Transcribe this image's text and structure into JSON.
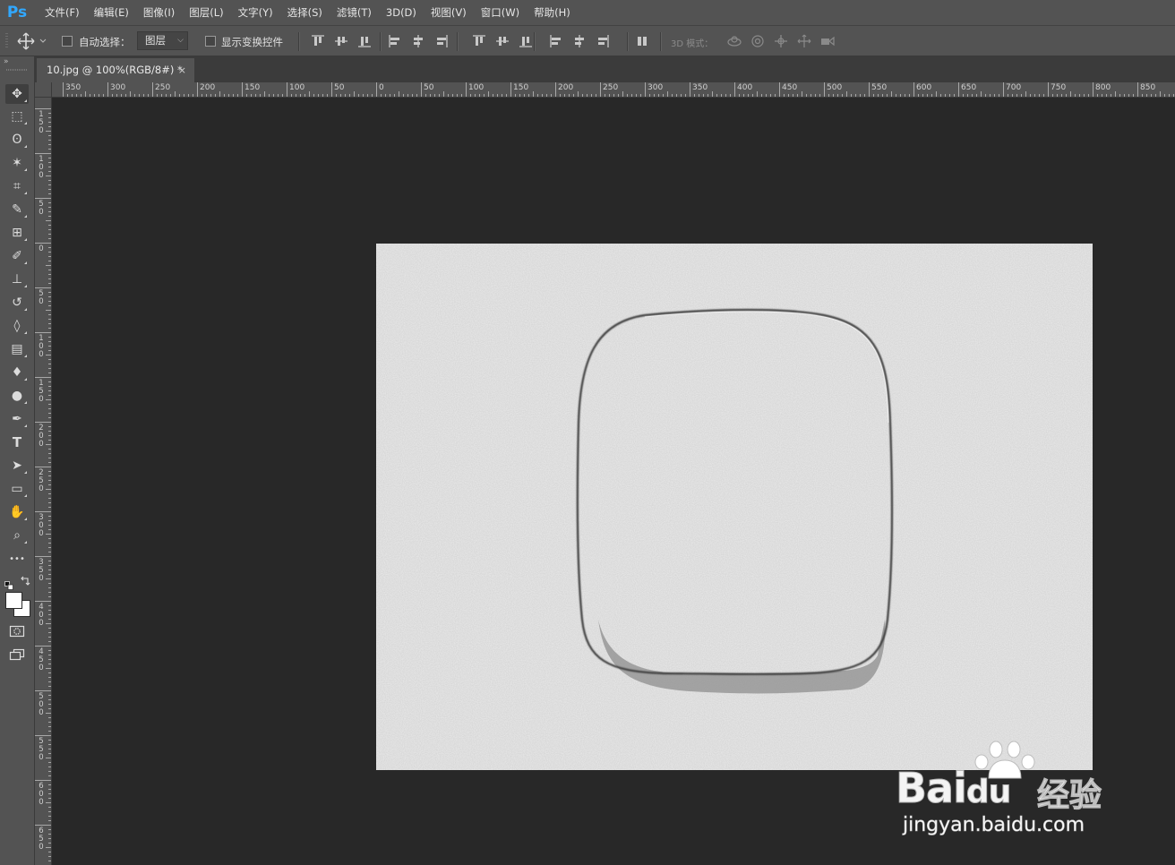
{
  "app": {
    "logo": "Ps"
  },
  "menu": [
    "文件(F)",
    "编辑(E)",
    "图像(I)",
    "图层(L)",
    "文字(Y)",
    "选择(S)",
    "滤镜(T)",
    "3D(D)",
    "视图(V)",
    "窗口(W)",
    "帮助(H)"
  ],
  "options": {
    "auto_select_label": "自动选择：",
    "auto_select_checked": false,
    "layer_select_value": "图层",
    "show_transform_label": "显示变换控件",
    "show_transform_checked": false,
    "mode_3d_label": "3D 模式："
  },
  "document": {
    "tab_title": "10.jpg @ 100%(RGB/8#) *",
    "close_glyph": "×"
  },
  "rulers": {
    "h_labels": [
      "350",
      "300",
      "250",
      "200",
      "150",
      "100",
      "50",
      "0",
      "50",
      "100",
      "150",
      "200",
      "250",
      "300",
      "350",
      "400",
      "450",
      "500",
      "550",
      "600",
      "650",
      "700",
      "750",
      "800",
      "850"
    ],
    "v_labels": [
      "1 5 0",
      "1 0 0",
      "5 0",
      "0",
      "5 0",
      "1 0 0",
      "1 5 0",
      "2 0 0",
      "2 5 0",
      "3 0 0",
      "3 5 0",
      "4 0 0",
      "4 5 0",
      "5 0 0",
      "5 5 0",
      "6 0 0",
      "6 5 0"
    ]
  },
  "tools": [
    {
      "name": "move-tool-icon",
      "glyph": "✥",
      "active": true
    },
    {
      "name": "marquee-tool-icon",
      "glyph": "⬚"
    },
    {
      "name": "lasso-tool-icon",
      "glyph": "ʘ"
    },
    {
      "name": "magic-wand-tool-icon",
      "glyph": "✶"
    },
    {
      "name": "crop-tool-icon",
      "glyph": "⌗"
    },
    {
      "name": "eyedropper-tool-icon",
      "glyph": "✎"
    },
    {
      "name": "frame-tool-icon",
      "glyph": "⊞"
    },
    {
      "name": "brush-tool-icon",
      "glyph": "✐"
    },
    {
      "name": "stamp-tool-icon",
      "glyph": "⊥"
    },
    {
      "name": "history-brush-tool-icon",
      "glyph": "↺"
    },
    {
      "name": "eraser-tool-icon",
      "glyph": "◊"
    },
    {
      "name": "gradient-tool-icon",
      "glyph": "▤"
    },
    {
      "name": "blur-tool-icon",
      "glyph": "♦"
    },
    {
      "name": "dodge-tool-icon",
      "glyph": "●"
    },
    {
      "name": "pen-tool-icon",
      "glyph": "✒"
    },
    {
      "name": "type-tool-icon",
      "glyph": "T"
    },
    {
      "name": "path-select-tool-icon",
      "glyph": "➤"
    },
    {
      "name": "rectangle-tool-icon",
      "glyph": "▭"
    },
    {
      "name": "hand-tool-icon",
      "glyph": "✋"
    },
    {
      "name": "zoom-tool-icon",
      "glyph": "⌕"
    },
    {
      "name": "more-tools-icon",
      "glyph": "•••"
    }
  ],
  "colors": {
    "accent_logo": "#31a8ff",
    "panel": "#535353",
    "workspace": "#282828",
    "canvas": "#ececec"
  },
  "watermark": {
    "brand": "Bai",
    "brand_suffix": "du",
    "cn": "经验",
    "url": "jingyan.baidu.com"
  }
}
